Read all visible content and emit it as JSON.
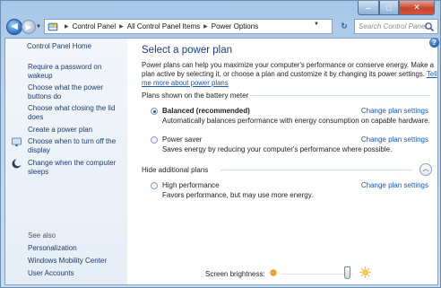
{
  "window": {
    "caption_buttons": {
      "minimize": "–",
      "maximize": "□",
      "close": "✕"
    }
  },
  "nav": {
    "breadcrumb": [
      "Control Panel",
      "All Control Panel Items",
      "Power Options"
    ],
    "search_placeholder": "Search Control Panel"
  },
  "sidebar": {
    "home": "Control Panel Home",
    "links": [
      "Require a password on wakeup",
      "Choose what the power buttons do",
      "Choose what closing the lid does",
      "Create a power plan",
      "Choose when to turn off the display",
      "Change when the computer sleeps"
    ],
    "see_also": "See also",
    "see_also_links": [
      "Personalization",
      "Windows Mobility Center",
      "User Accounts"
    ]
  },
  "main": {
    "title": "Select a power plan",
    "intro_text": "Power plans can help you maximize your computer's performance or conserve energy. Make a plan active by selecting it, or choose a plan and customize it by changing its power settings.",
    "intro_link": "Tell me more about power plans",
    "battery_group": "Plans shown on the battery meter",
    "hidden_group": "Hide additional plans",
    "change_link": "Change plan settings",
    "plans": [
      {
        "name": "Balanced (recommended)",
        "desc": "Automatically balances performance with energy consumption on capable hardware.",
        "selected": true
      },
      {
        "name": "Power saver",
        "desc": "Saves energy by reducing your computer's performance where possible.",
        "selected": false
      },
      {
        "name": "High performance",
        "desc": "Favors performance, but may use more energy.",
        "selected": false
      }
    ]
  },
  "brightness": {
    "label": "Screen brightness:",
    "level_percent": 92
  },
  "colors": {
    "link": "#1a57b0",
    "title": "#1d3d77",
    "sidebar_link": "#1c3a6b"
  }
}
